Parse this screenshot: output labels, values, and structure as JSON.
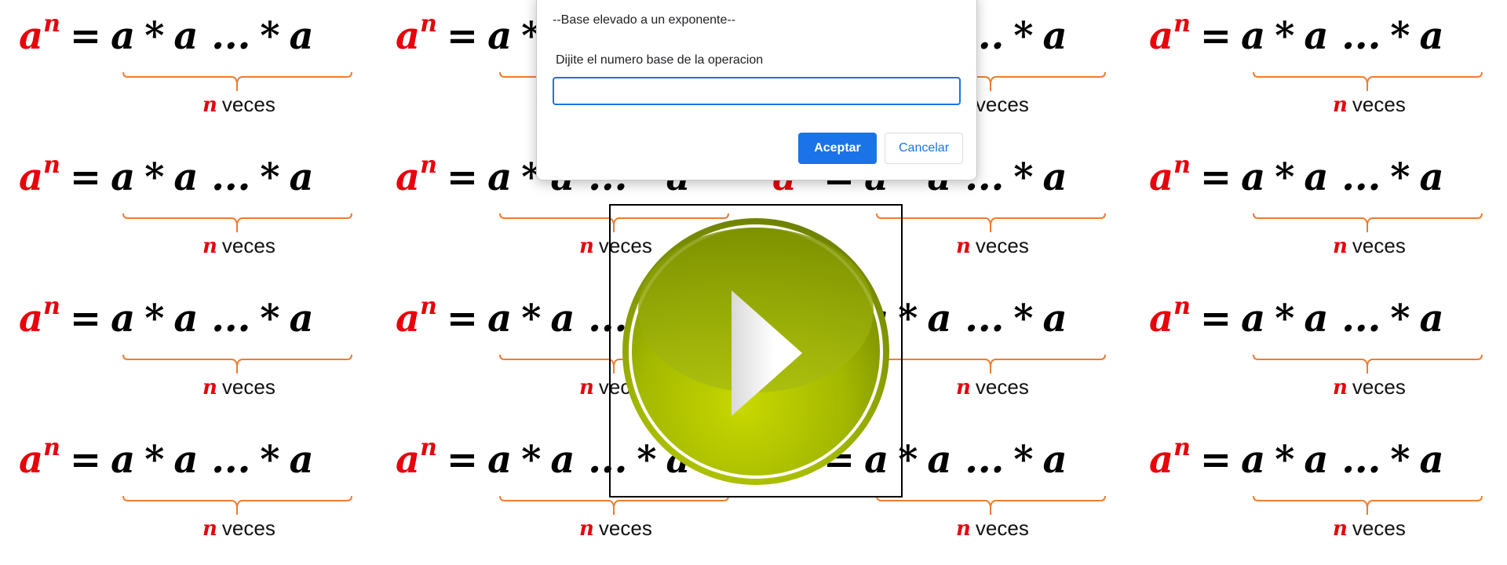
{
  "background": {
    "formula": {
      "base": "a",
      "exponent": "n",
      "equals": "=",
      "factor": "a",
      "times": "*",
      "ellipsis": "..."
    },
    "caption": {
      "variable": "n",
      "word": "veces"
    },
    "colors": {
      "accent": "#e8000b",
      "brace": "#ed7d31",
      "text": "#000000"
    }
  },
  "dialog": {
    "title": "--Base elevado a un exponente--",
    "message": "Dijite el numero base de la operacion",
    "input_value": "",
    "ok_label": "Aceptar",
    "cancel_label": "Cancelar",
    "accent": "#1a73e8"
  },
  "video": {
    "play_icon": "play-icon",
    "button_color": "#a8c100"
  }
}
